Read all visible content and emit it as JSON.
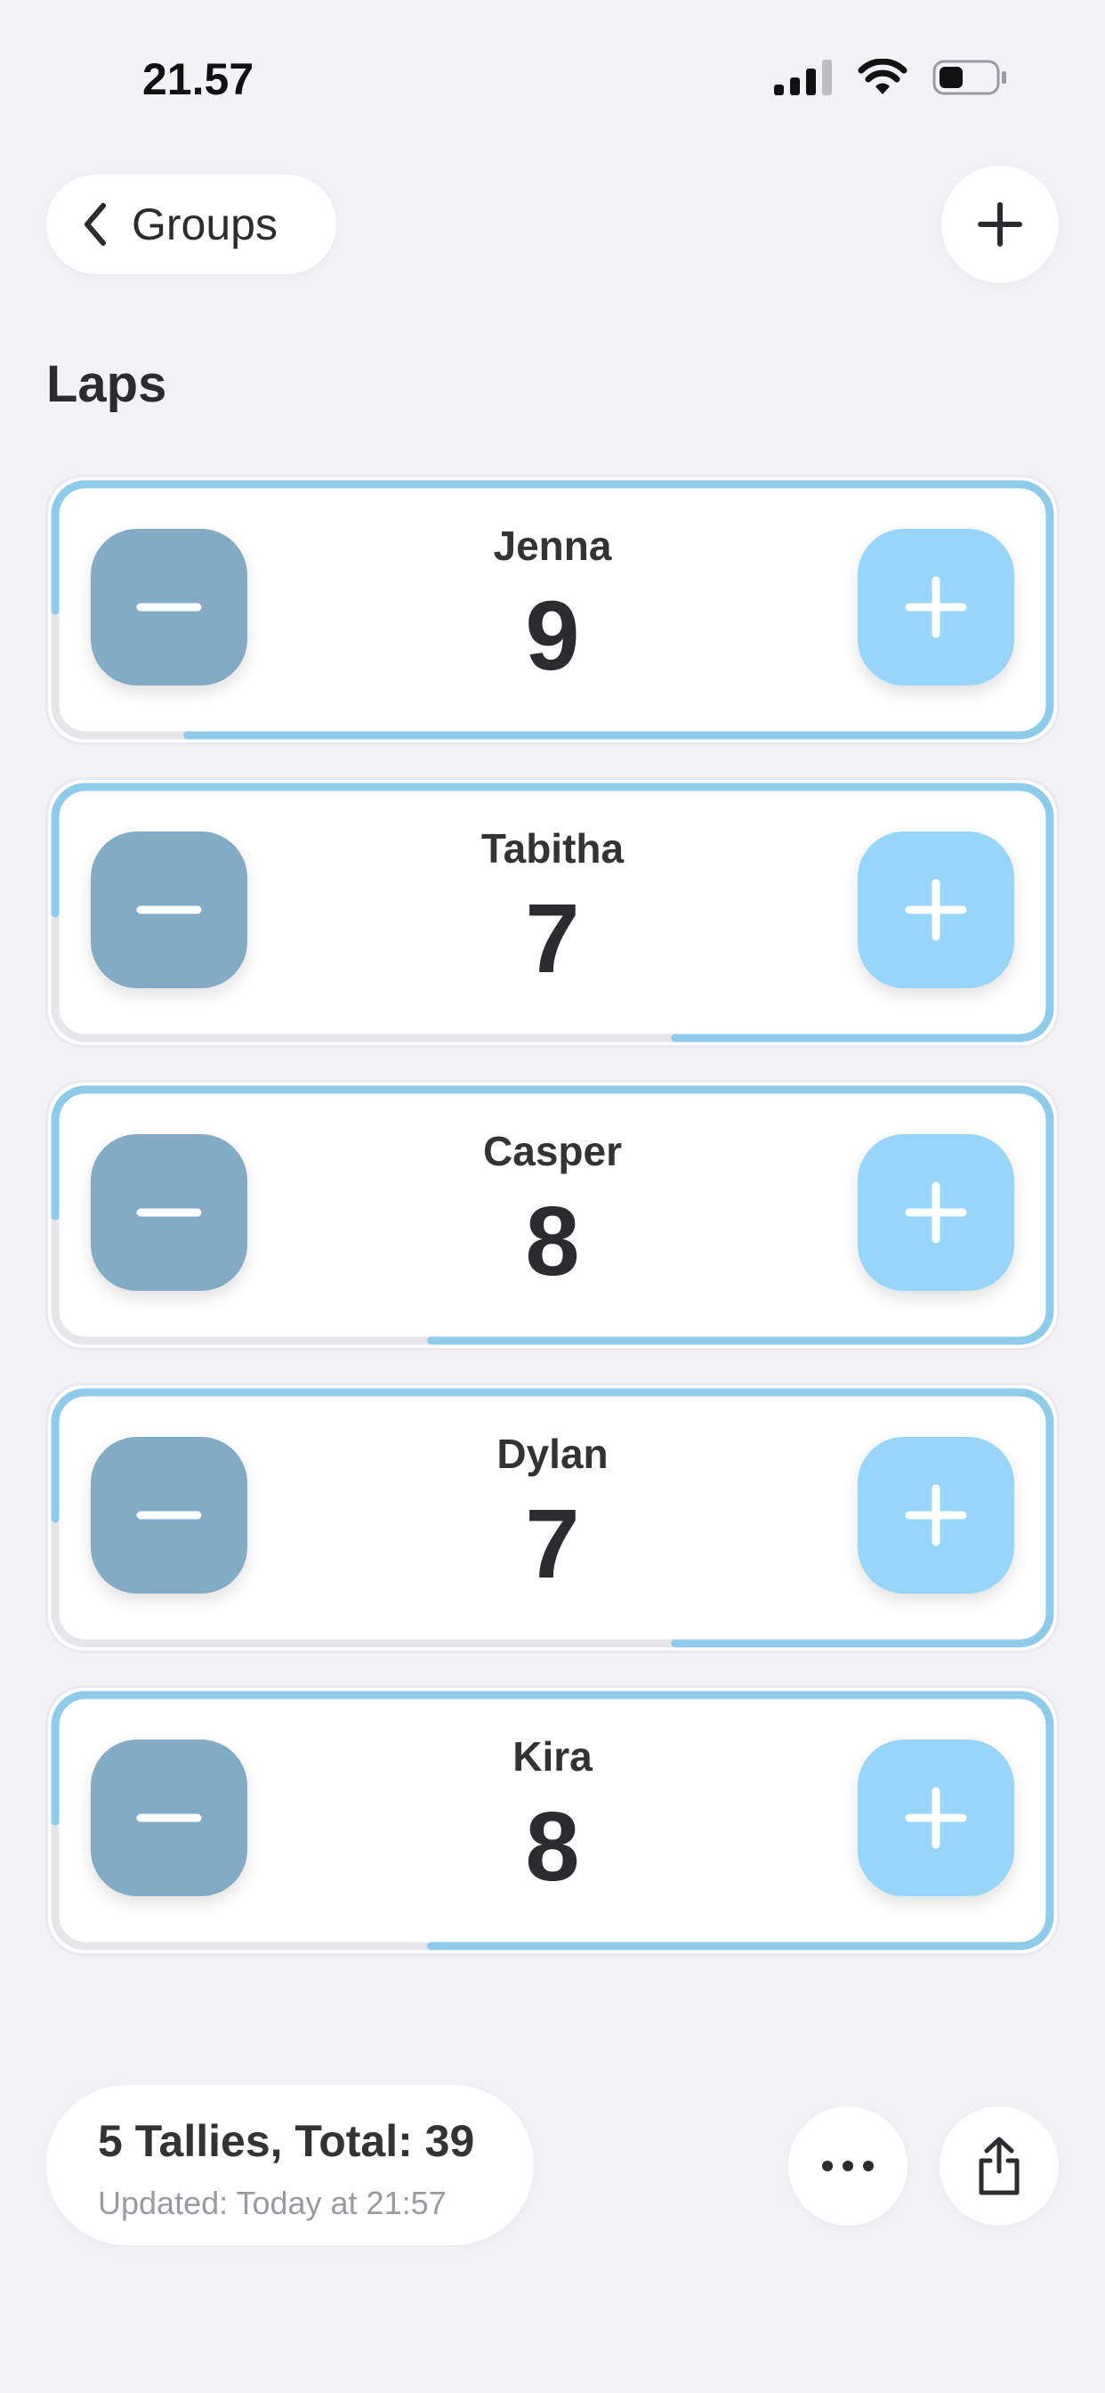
{
  "status_bar": {
    "time": "21.57"
  },
  "header": {
    "back_label": "Groups"
  },
  "page": {
    "title": "Laps"
  },
  "tallies": [
    {
      "name": "Jenna",
      "count": "9",
      "progress": 0.9
    },
    {
      "name": "Tabitha",
      "count": "7",
      "progress": 0.7
    },
    {
      "name": "Casper",
      "count": "8",
      "progress": 0.8
    },
    {
      "name": "Dylan",
      "count": "7",
      "progress": 0.7
    },
    {
      "name": "Kira",
      "count": "8",
      "progress": 0.8
    }
  ],
  "footer": {
    "summary": "5 Tallies, Total: 39",
    "updated": "Updated: Today at 21:57"
  },
  "colors": {
    "background": "#f2f2f7",
    "decrement": "#84abc6",
    "increment": "#97d6f8",
    "progress": "#8ecbeb",
    "track": "#e6e6ea"
  },
  "icons": {
    "back": "chevron-left-icon",
    "add": "plus-icon",
    "more": "ellipsis-icon",
    "share": "share-icon"
  }
}
